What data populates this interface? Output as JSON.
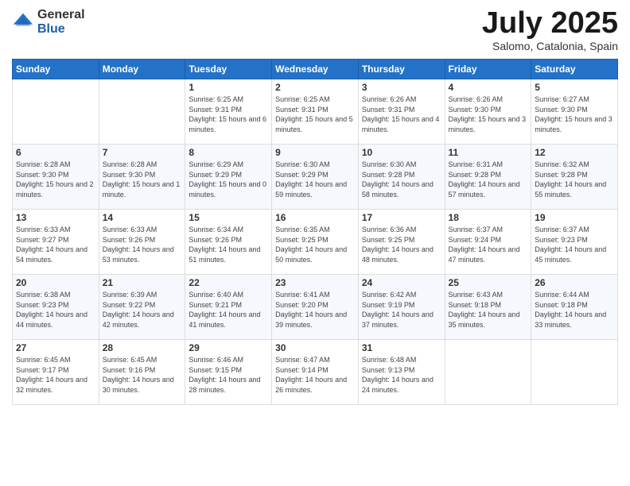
{
  "logo": {
    "general": "General",
    "blue": "Blue"
  },
  "header": {
    "month": "July 2025",
    "location": "Salomo, Catalonia, Spain"
  },
  "weekdays": [
    "Sunday",
    "Monday",
    "Tuesday",
    "Wednesday",
    "Thursday",
    "Friday",
    "Saturday"
  ],
  "weeks": [
    [
      {
        "day": "",
        "info": ""
      },
      {
        "day": "",
        "info": ""
      },
      {
        "day": "1",
        "info": "Sunrise: 6:25 AM\nSunset: 9:31 PM\nDaylight: 15 hours and 6 minutes."
      },
      {
        "day": "2",
        "info": "Sunrise: 6:25 AM\nSunset: 9:31 PM\nDaylight: 15 hours and 5 minutes."
      },
      {
        "day": "3",
        "info": "Sunrise: 6:26 AM\nSunset: 9:31 PM\nDaylight: 15 hours and 4 minutes."
      },
      {
        "day": "4",
        "info": "Sunrise: 6:26 AM\nSunset: 9:30 PM\nDaylight: 15 hours and 3 minutes."
      },
      {
        "day": "5",
        "info": "Sunrise: 6:27 AM\nSunset: 9:30 PM\nDaylight: 15 hours and 3 minutes."
      }
    ],
    [
      {
        "day": "6",
        "info": "Sunrise: 6:28 AM\nSunset: 9:30 PM\nDaylight: 15 hours and 2 minutes."
      },
      {
        "day": "7",
        "info": "Sunrise: 6:28 AM\nSunset: 9:30 PM\nDaylight: 15 hours and 1 minute."
      },
      {
        "day": "8",
        "info": "Sunrise: 6:29 AM\nSunset: 9:29 PM\nDaylight: 15 hours and 0 minutes."
      },
      {
        "day": "9",
        "info": "Sunrise: 6:30 AM\nSunset: 9:29 PM\nDaylight: 14 hours and 59 minutes."
      },
      {
        "day": "10",
        "info": "Sunrise: 6:30 AM\nSunset: 9:28 PM\nDaylight: 14 hours and 58 minutes."
      },
      {
        "day": "11",
        "info": "Sunrise: 6:31 AM\nSunset: 9:28 PM\nDaylight: 14 hours and 57 minutes."
      },
      {
        "day": "12",
        "info": "Sunrise: 6:32 AM\nSunset: 9:28 PM\nDaylight: 14 hours and 55 minutes."
      }
    ],
    [
      {
        "day": "13",
        "info": "Sunrise: 6:33 AM\nSunset: 9:27 PM\nDaylight: 14 hours and 54 minutes."
      },
      {
        "day": "14",
        "info": "Sunrise: 6:33 AM\nSunset: 9:26 PM\nDaylight: 14 hours and 53 minutes."
      },
      {
        "day": "15",
        "info": "Sunrise: 6:34 AM\nSunset: 9:26 PM\nDaylight: 14 hours and 51 minutes."
      },
      {
        "day": "16",
        "info": "Sunrise: 6:35 AM\nSunset: 9:25 PM\nDaylight: 14 hours and 50 minutes."
      },
      {
        "day": "17",
        "info": "Sunrise: 6:36 AM\nSunset: 9:25 PM\nDaylight: 14 hours and 48 minutes."
      },
      {
        "day": "18",
        "info": "Sunrise: 6:37 AM\nSunset: 9:24 PM\nDaylight: 14 hours and 47 minutes."
      },
      {
        "day": "19",
        "info": "Sunrise: 6:37 AM\nSunset: 9:23 PM\nDaylight: 14 hours and 45 minutes."
      }
    ],
    [
      {
        "day": "20",
        "info": "Sunrise: 6:38 AM\nSunset: 9:23 PM\nDaylight: 14 hours and 44 minutes."
      },
      {
        "day": "21",
        "info": "Sunrise: 6:39 AM\nSunset: 9:22 PM\nDaylight: 14 hours and 42 minutes."
      },
      {
        "day": "22",
        "info": "Sunrise: 6:40 AM\nSunset: 9:21 PM\nDaylight: 14 hours and 41 minutes."
      },
      {
        "day": "23",
        "info": "Sunrise: 6:41 AM\nSunset: 9:20 PM\nDaylight: 14 hours and 39 minutes."
      },
      {
        "day": "24",
        "info": "Sunrise: 6:42 AM\nSunset: 9:19 PM\nDaylight: 14 hours and 37 minutes."
      },
      {
        "day": "25",
        "info": "Sunrise: 6:43 AM\nSunset: 9:18 PM\nDaylight: 14 hours and 35 minutes."
      },
      {
        "day": "26",
        "info": "Sunrise: 6:44 AM\nSunset: 9:18 PM\nDaylight: 14 hours and 33 minutes."
      }
    ],
    [
      {
        "day": "27",
        "info": "Sunrise: 6:45 AM\nSunset: 9:17 PM\nDaylight: 14 hours and 32 minutes."
      },
      {
        "day": "28",
        "info": "Sunrise: 6:45 AM\nSunset: 9:16 PM\nDaylight: 14 hours and 30 minutes."
      },
      {
        "day": "29",
        "info": "Sunrise: 6:46 AM\nSunset: 9:15 PM\nDaylight: 14 hours and 28 minutes."
      },
      {
        "day": "30",
        "info": "Sunrise: 6:47 AM\nSunset: 9:14 PM\nDaylight: 14 hours and 26 minutes."
      },
      {
        "day": "31",
        "info": "Sunrise: 6:48 AM\nSunset: 9:13 PM\nDaylight: 14 hours and 24 minutes."
      },
      {
        "day": "",
        "info": ""
      },
      {
        "day": "",
        "info": ""
      }
    ]
  ]
}
